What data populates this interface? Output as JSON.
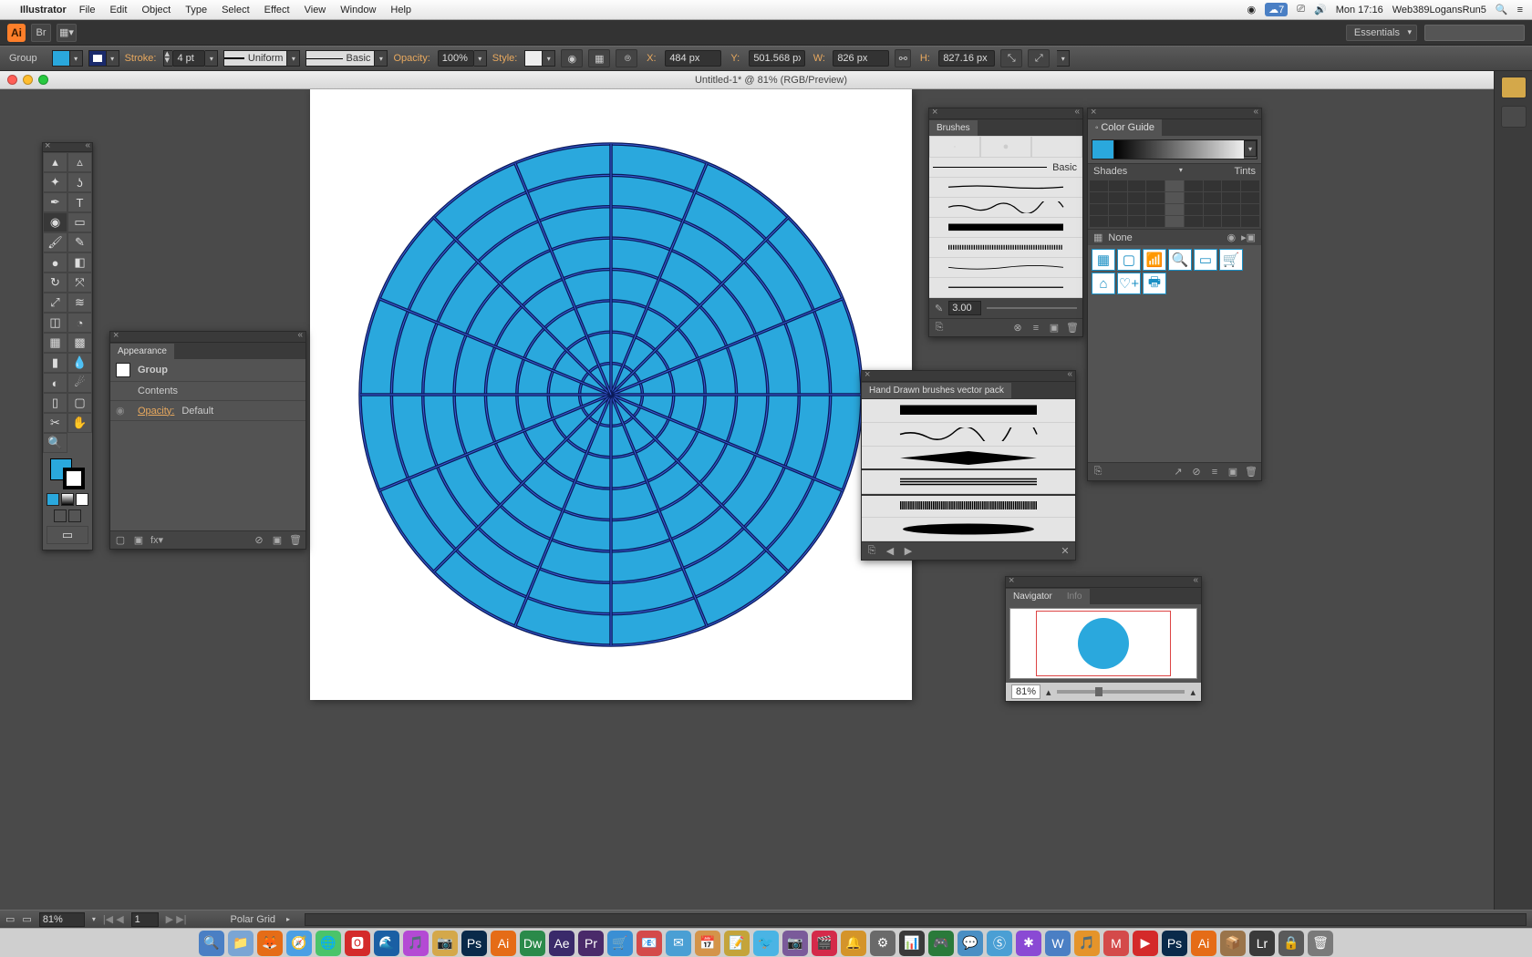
{
  "mac_menu": {
    "app": "Illustrator",
    "items": [
      "File",
      "Edit",
      "Object",
      "Type",
      "Select",
      "Effect",
      "View",
      "Window",
      "Help"
    ],
    "time": "Mon 17:16",
    "right_text": "Web389LogansRun5",
    "cloud_badge": "7"
  },
  "app_bar": {
    "workspace": "Essentials"
  },
  "control": {
    "selection": "Group",
    "stroke_label": "Stroke:",
    "stroke_weight": "4 pt",
    "stroke_profile": "Uniform",
    "brush_def": "Basic",
    "opacity_label": "Opacity:",
    "opacity": "100%",
    "style_label": "Style:",
    "x_label": "X:",
    "x": "484 px",
    "y_label": "Y:",
    "y": "501.568 px",
    "w_label": "W:",
    "w": "826 px",
    "h_label": "H:",
    "h": "827.16 px",
    "fill_color": "#2aa8dd",
    "stroke_color": "#1a2a6b"
  },
  "doc_title": "Untitled-1* @ 81% (RGB/Preview)",
  "polar_grid": {
    "fill": "#2aa8dd",
    "stroke": "#0a1a5b",
    "sel_stroke": "#3a5fd8",
    "radial_divs": 16,
    "rings": 8
  },
  "appearance": {
    "title": "Appearance",
    "type": "Group",
    "contents": "Contents",
    "opacity_label": "Opacity:",
    "opacity_value": "Default"
  },
  "brushes": {
    "title": "Brushes",
    "basic_label": "Basic",
    "brush_width": "3.00"
  },
  "hand_drawn": {
    "title": "Hand Drawn brushes vector pack"
  },
  "color_guide": {
    "title": "Color Guide",
    "shades": "Shades",
    "tints": "Tints",
    "none": "None"
  },
  "navigator": {
    "tab1": "Navigator",
    "tab2": "Info",
    "zoom": "81%"
  },
  "status": {
    "zoom": "81%",
    "page": "1",
    "tool": "Polar Grid"
  },
  "dock_apps": [
    "🔍",
    "📁",
    "🦊",
    "🧭",
    "🌐",
    "🅾",
    "🌊",
    "🎵",
    "📷",
    "Ps",
    "Ai",
    "Dw",
    "Ae",
    "Pr",
    "🛒",
    "📧",
    "✉",
    "📅",
    "📝",
    "🐦",
    "📷",
    "🎬",
    "🔔",
    "⚙",
    "📊",
    "🎮",
    "💬",
    "Ⓢ",
    "✱",
    "W",
    "🎵",
    "M",
    "▶",
    "Ps",
    "Ai",
    "📦",
    "Lr",
    "🔒",
    "🗑"
  ]
}
